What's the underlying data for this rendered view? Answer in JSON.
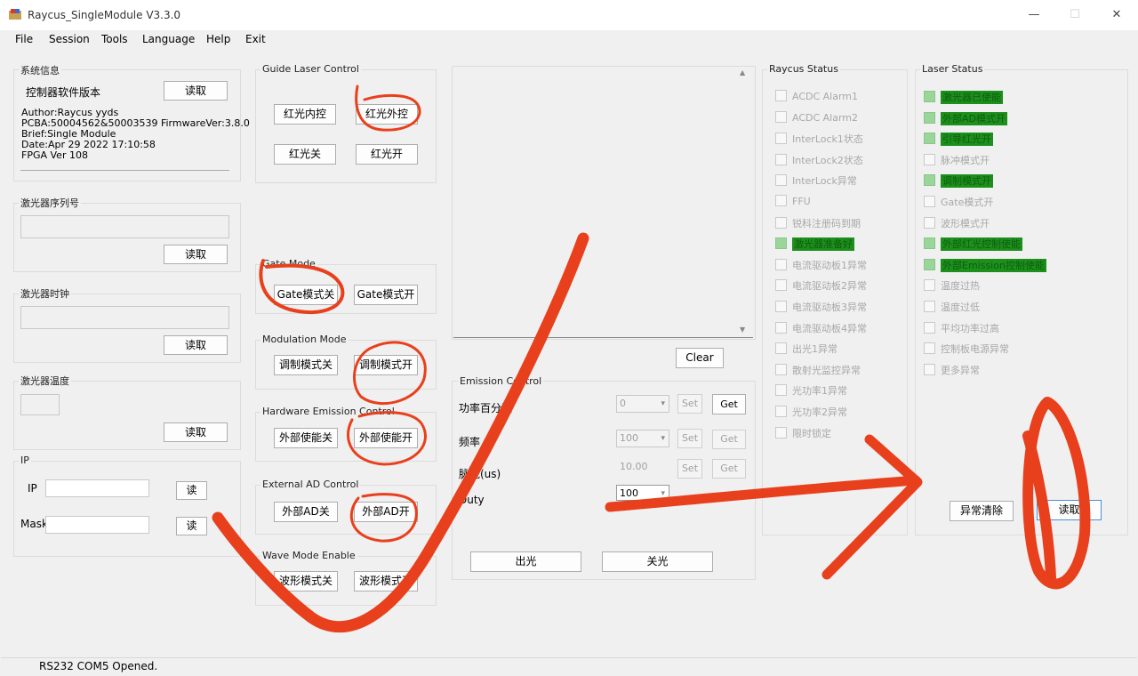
{
  "window": {
    "title": "Raycus_SingleModule V3.3.0",
    "minimize_glyph": "—",
    "maximize_glyph": "☐",
    "close_glyph": "✕"
  },
  "menu": [
    "File",
    "Session",
    "Tools",
    "Language",
    "Help",
    "Exit"
  ],
  "sysinfo": {
    "title": "系统信息",
    "label": "控制器软件版本",
    "read_btn": "读取",
    "lines": [
      "Author:Raycus yyds",
      "PCBA:50004562&50003539 FirmwareVer:3.8.0",
      "Brief:Single Module",
      "Date:Apr 29 2022  17:10:58",
      "FPGA Ver 108"
    ]
  },
  "serial": {
    "title": "激光器序列号",
    "read_btn": "读取"
  },
  "clock": {
    "title": "激光器时钟",
    "read_btn": "读取"
  },
  "temperature": {
    "title": "激光器温度",
    "read_btn": "读取"
  },
  "ip": {
    "title": "IP",
    "ip_label": "IP",
    "mask_label": "Mask",
    "read_btn": "读",
    "read_btn2": "读"
  },
  "guide": {
    "title": "Guide Laser Control",
    "internal": "红光内控",
    "external": "红光外控",
    "off": "红光关",
    "on": "红光开"
  },
  "gate": {
    "title": "Gate Mode",
    "off": "Gate模式关",
    "on": "Gate模式开"
  },
  "modulation": {
    "title": "Modulation Mode",
    "off": "调制模式关",
    "on": "调制模式开"
  },
  "hw_emission": {
    "title": "Hardware Emission Control",
    "off": "外部使能关",
    "on": "外部使能开"
  },
  "ext_ad": {
    "title": "External AD Control",
    "off": "外部AD关",
    "on": "外部AD开"
  },
  "wave": {
    "title": "Wave Mode Enable",
    "off": "波形模式关",
    "on": "波形模式开"
  },
  "log": {
    "clear_btn": "Clear",
    "scroll_up": "▲",
    "scroll_down": "▼"
  },
  "emission": {
    "title": "Emission Control",
    "rows": [
      {
        "label": "功率百分数",
        "value": "0",
        "set": "Set",
        "get": "Get"
      },
      {
        "label": "频率",
        "value": "100",
        "set": "Set",
        "get": "Get"
      },
      {
        "label": "脉宽(us)",
        "value": "10.00",
        "set": "Set",
        "get": "Get"
      },
      {
        "label": "Duty",
        "value": "100"
      }
    ],
    "emit_btn": "出光",
    "stop_btn": "关光"
  },
  "raycus_status": {
    "title": "Raycus Status",
    "items": [
      {
        "label": "ACDC Alarm1",
        "on": false
      },
      {
        "label": "ACDC Alarm2",
        "on": false
      },
      {
        "label": "InterLock1状态",
        "on": false
      },
      {
        "label": "InterLock2状态",
        "on": false
      },
      {
        "label": "InterLock异常",
        "on": false
      },
      {
        "label": "FFU",
        "on": false
      },
      {
        "label": "锐科注册码到期",
        "on": false
      },
      {
        "label": "激光器准备好",
        "on": true
      },
      {
        "label": "电流驱动板1异常",
        "on": false
      },
      {
        "label": "电流驱动板2异常",
        "on": false
      },
      {
        "label": "电流驱动板3异常",
        "on": false
      },
      {
        "label": "电流驱动板4异常",
        "on": false
      },
      {
        "label": "出光1异常",
        "on": false
      },
      {
        "label": "散射光监控异常",
        "on": false
      },
      {
        "label": "光功率1异常",
        "on": false
      },
      {
        "label": "光功率2异常",
        "on": false
      },
      {
        "label": "限时锁定",
        "on": false
      }
    ]
  },
  "laser_status": {
    "title": "Laser Status",
    "items": [
      {
        "label": "激光器已使能",
        "on": true
      },
      {
        "label": "外部AD模式开",
        "on": true
      },
      {
        "label": "引导红光开",
        "on": true
      },
      {
        "label": "脉冲模式开",
        "on": false
      },
      {
        "label": "调制模式开",
        "on": true
      },
      {
        "label": "Gate模式开",
        "on": false
      },
      {
        "label": "波形模式开",
        "on": false
      },
      {
        "label": "外部红光控制使能",
        "on": true
      },
      {
        "label": "外部Emission控制使能",
        "on": true
      },
      {
        "label": "温度过热",
        "on": false
      },
      {
        "label": "温度过低",
        "on": false
      },
      {
        "label": "平均功率过高",
        "on": false
      },
      {
        "label": "控制板电源异常",
        "on": false
      },
      {
        "label": "更多异常",
        "on": false
      }
    ],
    "clear_btn": "异常清除",
    "read_btn": "读取"
  },
  "status_bar": {
    "text": "RS232 COM5 Opened."
  },
  "colors": {
    "status_on_bg": "#1d8f1d",
    "annotation": "#e8401c"
  }
}
